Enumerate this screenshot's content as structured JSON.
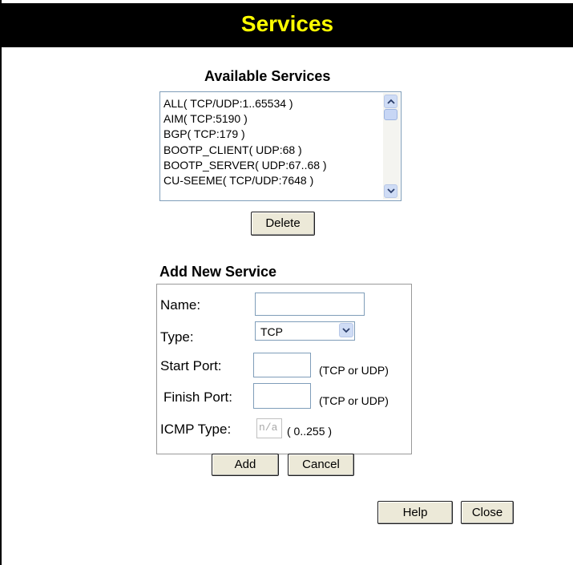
{
  "header": {
    "title": "Services"
  },
  "available_services": {
    "heading": "Available Services",
    "items": [
      "ALL( TCP/UDP:1..65534 )",
      "AIM( TCP:5190 )",
      "BGP( TCP:179 )",
      "BOOTP_CLIENT( UDP:68 )",
      "BOOTP_SERVER( UDP:67..68 )",
      "CU-SEEME( TCP/UDP:7648 )"
    ],
    "delete_label": "Delete"
  },
  "add_new_service": {
    "heading": "Add New Service",
    "name_label": "Name:",
    "name_value": "",
    "type_label": "Type:",
    "type_value": "TCP",
    "start_port_label": "Start Port:",
    "start_port_value": "",
    "start_port_note": "(TCP or UDP)",
    "finish_port_label": "Finish Port:",
    "finish_port_value": "",
    "finish_port_note": "(TCP or UDP)",
    "icmp_type_label": "ICMP Type:",
    "icmp_type_value": "n/a",
    "icmp_type_note": "( 0..255 )",
    "add_label": "Add",
    "cancel_label": "Cancel"
  },
  "footer": {
    "help_label": "Help",
    "close_label": "Close"
  },
  "colors": {
    "title_bg": "#000000",
    "title_text": "#ffff00"
  }
}
